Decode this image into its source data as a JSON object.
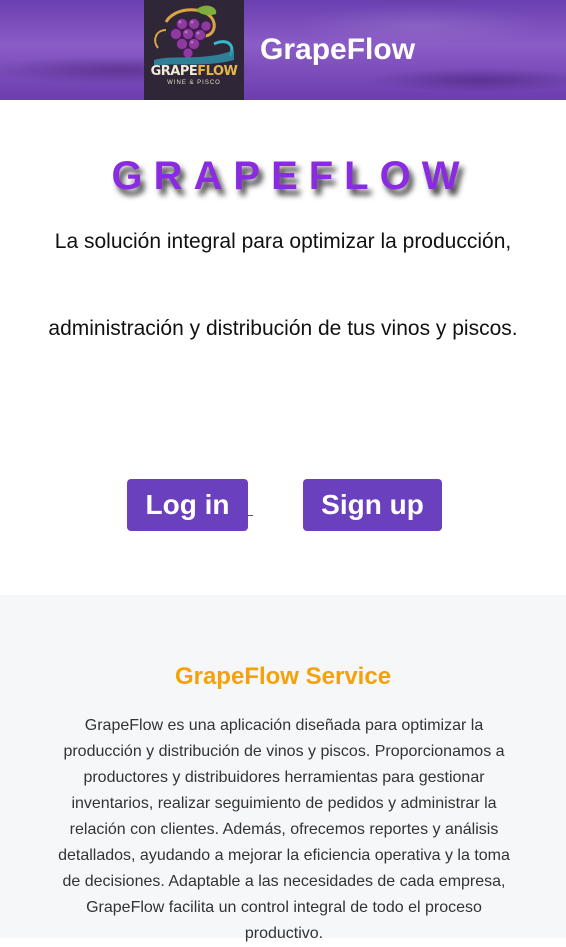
{
  "header": {
    "logo_text_grape": "GRAPE",
    "logo_text_flow": "FLOW",
    "logo_subtext": "WINE & PISCO",
    "app_title": "GrapeFlow"
  },
  "hero": {
    "title": "GRAPEFLOW",
    "tagline_line1": "La solución integral para optimizar la producción,",
    "tagline_line2": "administración y distribución de tus vinos y piscos."
  },
  "actions": {
    "login_label": "Log in",
    "signup_label": "Sign up"
  },
  "service": {
    "title": "GrapeFlow Service",
    "description": "GrapeFlow es una aplicación diseñada para optimizar la producción y distribución de vinos y piscos. Proporcionamos a productores y distribuidores herramientas para gestionar inventarios, realizar seguimiento de pedidos y administrar la relación con clientes. Además, ofrecemos reportes y análisis detallados, ayudando a mejorar la eficiencia operativa y la toma de decisiones. Adaptable a las necesidades de cada empresa, GrapeFlow facilita un control integral de todo el proceso productivo."
  },
  "colors": {
    "header_purple": "#6a3fb0",
    "button_purple": "#6a40bf",
    "hero_title": "#8a2be2",
    "service_title": "#f5a10a",
    "service_bg": "#f5f7f9"
  },
  "icons": {
    "logo": "grape-cluster-logo-icon"
  }
}
